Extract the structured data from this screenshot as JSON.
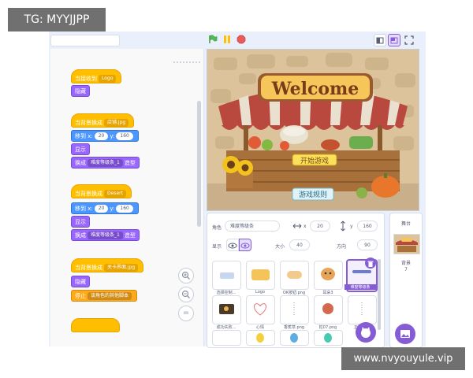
{
  "watermark_top": "TG: MYYJJPP",
  "watermark_bottom": "www.nvyouyule.vip",
  "colors": {
    "events": "#ffbf00",
    "looks": "#9966ff",
    "motion": "#4c97ff",
    "control": "#ffab19",
    "accent": "#855cd6"
  },
  "controls": {
    "flag_icon": "green-flag-icon",
    "pause_icon": "pause-icon",
    "stop_icon": "stop-icon"
  },
  "stage": {
    "sign_text": "Welcome",
    "board_text_1": "开始游戏",
    "board_text_2": "游戏规则"
  },
  "code": {
    "stack1": {
      "hat": "当接收到",
      "hat_dd": "Logo",
      "b1": "隐藏"
    },
    "stack2": {
      "hat": "当背景换成",
      "hat_dd": "店铺.jpg",
      "move_label": "移到 x:",
      "x": "20",
      "y_label": "y:",
      "y": "160",
      "show": "显示",
      "switch": "换成",
      "switch_dd": "难度等级条_1",
      "switch_tail": "造型"
    },
    "stack3": {
      "hat": "当背景换成",
      "hat_dd": "Desert",
      "move_label": "移到 x:",
      "x": "20",
      "y_label": "y:",
      "y": "160",
      "show": "显示",
      "switch": "换成",
      "switch_dd": "难度等级条_1",
      "switch_tail": "造型"
    },
    "stack4": {
      "hat": "当背景换成",
      "hat_dd": "关卡界面.jpg",
      "hide": "隐藏",
      "stop": "停止",
      "stop_dd": "该角色的其他脚本"
    }
  },
  "sprite_info": {
    "sprite_label": "角色",
    "sprite_name": "难度等级条",
    "x_label": "x",
    "x_value": "20",
    "y_label": "y",
    "y_value": "160",
    "show_label": "显示",
    "size_label": "大小",
    "size_value": "40",
    "direction_label": "方向",
    "direction_value": "90"
  },
  "sprites": [
    {
      "name": "选择控制..."
    },
    {
      "name": "Logo"
    },
    {
      "name": "OK按钮.png"
    },
    {
      "name": "耳朵3"
    },
    {
      "name": "难度等级条"
    },
    {
      "name": "成功失败..."
    },
    {
      "name": "心情"
    },
    {
      "name": "香蕉草.png"
    },
    {
      "name": "粒07.png"
    },
    {
      "name": "正确答案"
    }
  ],
  "stage_panel": {
    "title": "舞台",
    "backdrops_label": "背景",
    "backdrops_count": "7"
  }
}
